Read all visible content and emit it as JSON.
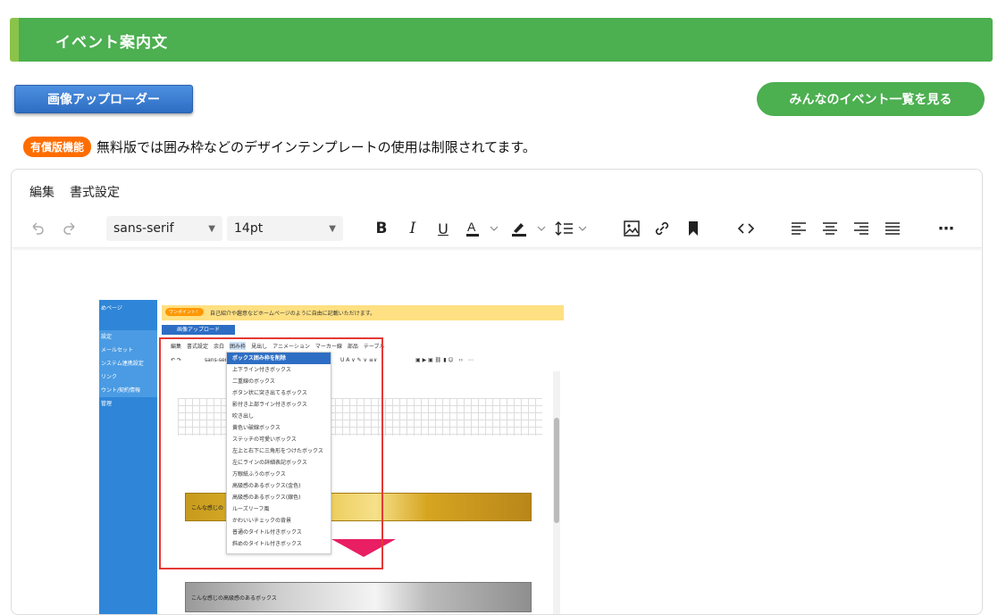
{
  "header": {
    "title": "イベント案内文"
  },
  "buttons": {
    "uploader": "画像アップローダー",
    "events_list": "みんなのイベント一覧を見る"
  },
  "notice": {
    "badge": "有償版機能",
    "text": "無料版では囲み枠などのデザインテンプレートの使用は制限されてます。"
  },
  "editor": {
    "menu": [
      "編集",
      "書式設定"
    ],
    "toolbar": {
      "font_family": "sans-serif",
      "font_size": "14pt",
      "icons": [
        "undo-icon",
        "redo-icon",
        "bold-icon",
        "italic-icon",
        "underline-icon",
        "text-color-icon",
        "highlight-color-icon",
        "line-height-icon",
        "image-icon",
        "link-icon",
        "bookmark-icon",
        "code-icon",
        "align-left-icon",
        "align-center-icon",
        "align-right-icon",
        "justify-icon",
        "more-icon"
      ]
    },
    "embedded_screenshot": {
      "sidebar_items": [
        "めページ",
        "設定",
        "メールセット",
        "ンステム連携設定",
        "リンク",
        "ウント/契約情報",
        "管理"
      ],
      "warn_pill": "ワンポイント！",
      "warn_text": "自己紹介や趣意などホームページのように自由に記載いただけます。",
      "upload_button": "画像アップロード",
      "menu": [
        "編集",
        "書式設定",
        "余白",
        "囲み枠",
        "見出し",
        "アニメーション",
        "マーカー線",
        "部品",
        "テーブル"
      ],
      "toolbar_font": "sans-seri",
      "dropdown_options": [
        "ボックス囲み枠を削除",
        "上下ライン付きボックス",
        "二重線のボックス",
        "ボタン状に突き出てるボックス",
        "影付き上部ライン付きボックス",
        "吹き出し",
        "黄色い破線ボックス",
        "ステッチの可愛いボックス",
        "左上と右下に三角形をつけたボックス",
        "左にラインの詳細表記ボックス",
        "方眼紙ふうのボックス",
        "高級感のあるボックス(金色)",
        "高級感のあるボックス(銀色)",
        "ルーズリーフ風",
        "かわいいチェックの背景",
        "普通のタイトル付きボックス",
        "斜めのタイトル付きボックス"
      ],
      "gold_box_text": "こんな感じの",
      "silver_box_text": "こんな感じの高級感のあるボックス"
    }
  }
}
